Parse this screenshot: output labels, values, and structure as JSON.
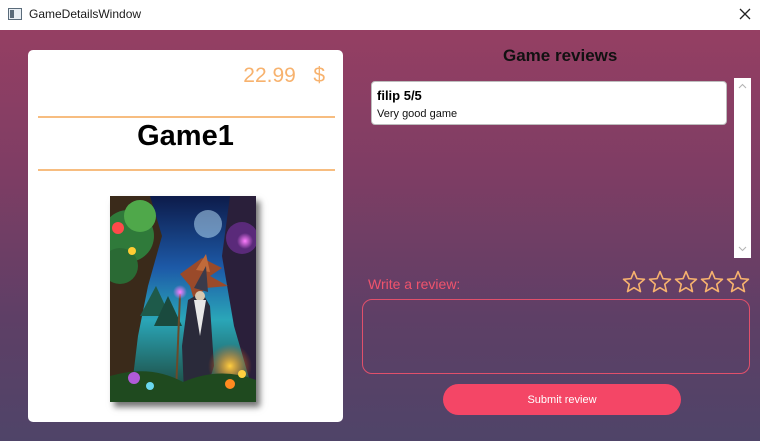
{
  "window": {
    "title": "GameDetailsWindow"
  },
  "game": {
    "price": "22.99   $",
    "title": "Game1",
    "cover_alt": "Game1 cover art"
  },
  "reviews": {
    "heading": "Game reviews",
    "items": [
      {
        "header": "filip 5/5",
        "text": "Very good game"
      }
    ]
  },
  "write_review": {
    "label": "Write a review:",
    "star_count": 5,
    "selected_stars": 0,
    "input_value": "",
    "submit_label": "Submit review"
  },
  "colors": {
    "accent": "#f44666",
    "price": "#f7b26e",
    "divider": "#f7bd80",
    "label": "#f0536d",
    "star": "#f7b26e"
  },
  "icons": [
    "app-icon",
    "close-icon",
    "star-icon",
    "chevron-up-icon",
    "chevron-down-icon"
  ]
}
